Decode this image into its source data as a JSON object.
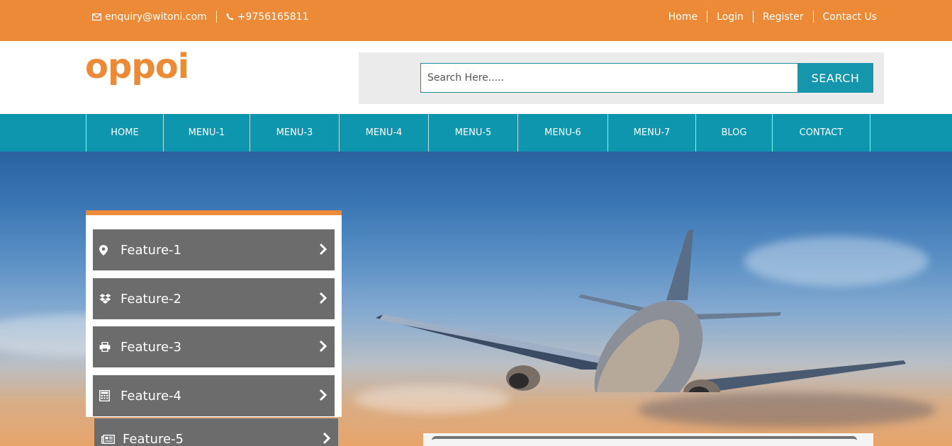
{
  "topbar": {
    "email": "enquiry@witoni.com",
    "phone": "+9756165811",
    "links": [
      "Home",
      "Login",
      "Register",
      "Contact Us"
    ]
  },
  "logo": {
    "text": "oppoi"
  },
  "search": {
    "placeholder": "Search Here.....",
    "button_label": "SEARCH"
  },
  "nav": {
    "items": [
      "HOME",
      "MENU-1",
      "MENU-3",
      "MENU-4",
      "MENU-5",
      "MENU-6",
      "MENU-7",
      "BLOG",
      "CONTACT"
    ]
  },
  "features": [
    {
      "label": "Feature-1",
      "icon": "map-marker-icon"
    },
    {
      "label": "Feature-2",
      "icon": "dropbox-icon"
    },
    {
      "label": "Feature-3",
      "icon": "print-icon"
    },
    {
      "label": "Feature-4",
      "icon": "calculator-icon"
    },
    {
      "label": "Feature-5",
      "icon": "newspaper-icon"
    }
  ],
  "colors": {
    "orange": "#ec8a37",
    "teal": "#0e96ae",
    "feature_bg": "#6c6c6c"
  }
}
